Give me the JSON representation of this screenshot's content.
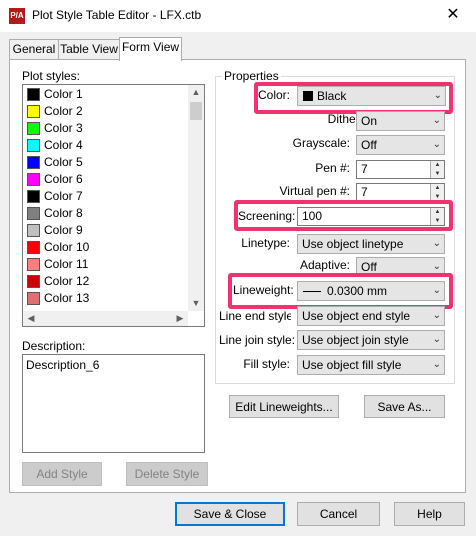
{
  "window": {
    "title": "Plot Style Table Editor - LFX.ctb",
    "app_icon_text": "P/A",
    "close_glyph": "✕"
  },
  "tabs": [
    {
      "label": "General"
    },
    {
      "label": "Table View"
    },
    {
      "label": "Form View"
    }
  ],
  "plot_styles": {
    "label": "Plot styles:",
    "items": [
      {
        "label": "Color 1",
        "color": "#ff0000"
      },
      {
        "label": "Color 2",
        "color": "#ffff00"
      },
      {
        "label": "Color 3",
        "color": "#00ff00"
      },
      {
        "label": "Color 4",
        "color": "#00ffff"
      },
      {
        "label": "Color 5",
        "color": "#0000ff"
      },
      {
        "label": "Color 6",
        "color": "#ff00ff"
      },
      {
        "label": "Color 7",
        "color": "#000000"
      },
      {
        "label": "Color 8",
        "color": "#808080"
      },
      {
        "label": "Color 9",
        "color": "#c0c0c0"
      },
      {
        "label": "Color 10",
        "color": "#ff0000"
      },
      {
        "label": "Color 11",
        "color": "#ff7f7f"
      },
      {
        "label": "Color 12",
        "color": "#cc0000"
      },
      {
        "label": "Color 13",
        "color": "#e07070"
      }
    ]
  },
  "description": {
    "label": "Description:",
    "value": "Description_6"
  },
  "style_buttons": {
    "add": "Add Style",
    "delete": "Delete Style"
  },
  "properties": {
    "title": "Properties",
    "color_label": "Color:",
    "color_value": "Black",
    "color_swatch": "#000000",
    "dither_label": "Dither:",
    "dither_value": "On",
    "grayscale_label": "Grayscale:",
    "grayscale_value": "Off",
    "pen_label": "Pen #:",
    "pen_value": "7",
    "virtual_pen_label": "Virtual pen #:",
    "virtual_pen_value": "7",
    "screening_label": "Screening:",
    "screening_value": "100",
    "linetype_label": "Linetype:",
    "linetype_value": "Use object linetype",
    "adaptive_label": "Adaptive:",
    "adaptive_value": "Off",
    "lineweight_label": "Lineweight:",
    "lineweight_value": "0.0300 mm",
    "line_end_label": "Line end style:",
    "line_end_value": "Use object end style",
    "line_join_label": "Line join style:",
    "line_join_value": "Use object join style",
    "fill_label": "Fill style:",
    "fill_value": "Use object fill style"
  },
  "prop_buttons": {
    "edit_lineweights": "Edit Lineweights...",
    "save_as": "Save As..."
  },
  "footer": {
    "save_close": "Save & Close",
    "cancel": "Cancel",
    "help": "Help"
  },
  "highlight_color": "#f0336f"
}
